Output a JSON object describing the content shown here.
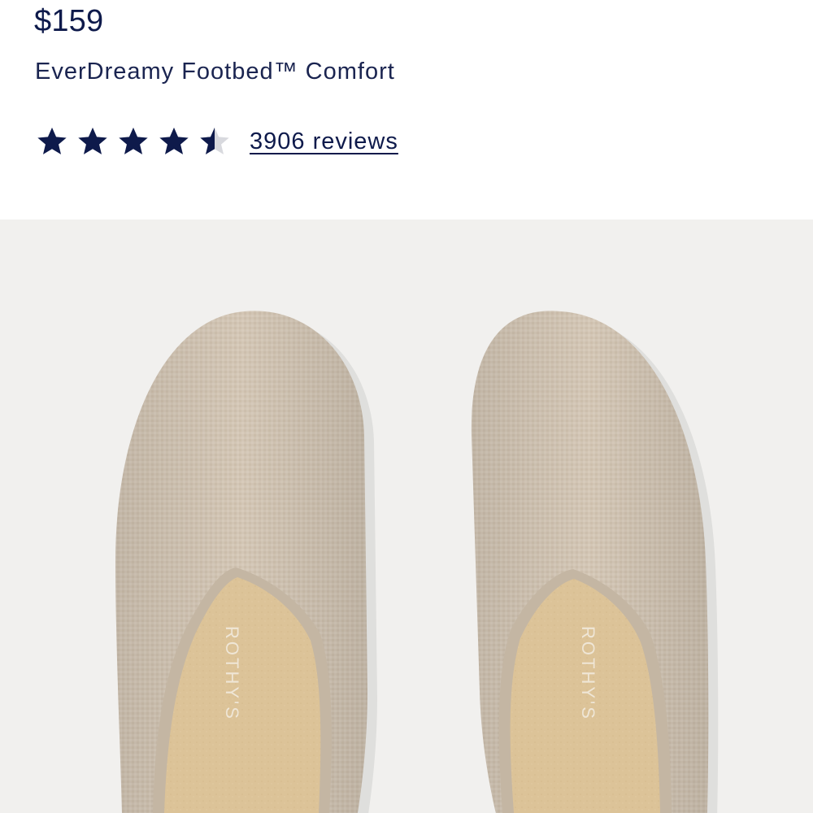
{
  "product": {
    "price": "$159",
    "feature": "EverDreamy Footbed™ Comfort",
    "rating": {
      "value": 4.5,
      "max": 5,
      "star_color": "#0e1a4b",
      "empty_star_color": "#d8d9de"
    },
    "reviews_label": "3906 reviews"
  },
  "image": {
    "subject": "pair of beige knit mule slippers",
    "insole_brand": "ROTHY'S",
    "colors": {
      "background": "#f1f0ee",
      "knit": "#d3c6b5",
      "insole": "#dcc398"
    }
  }
}
